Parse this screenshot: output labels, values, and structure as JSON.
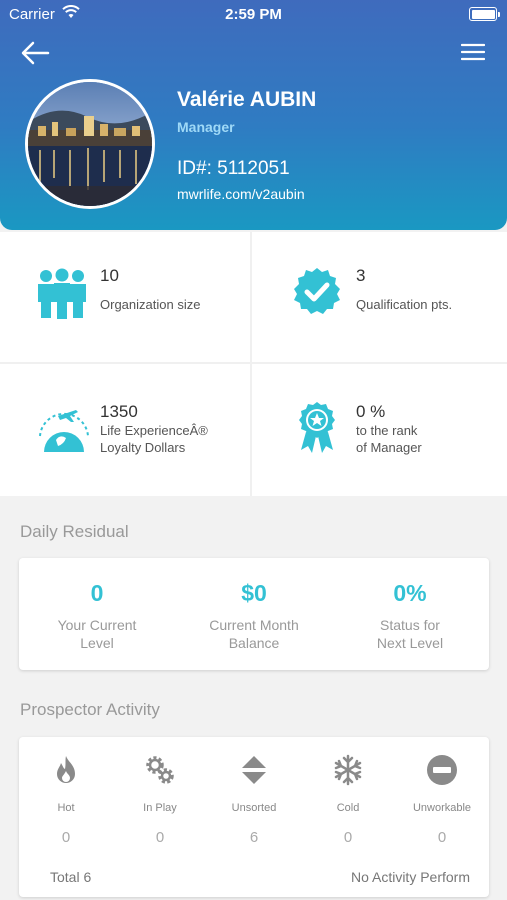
{
  "statusbar": {
    "carrier": "Carrier",
    "time": "2:59 PM"
  },
  "profile": {
    "name": "Valérie AUBIN",
    "role": "Manager",
    "id": "ID#: 5112051",
    "url": "mwrlife.com/v2aubin"
  },
  "stats": [
    {
      "value": "10",
      "label_line1": "Organization size",
      "label_line2": "",
      "icon": "team-icon"
    },
    {
      "value": "3",
      "label_line1": "Qualification pts.",
      "label_line2": "",
      "icon": "check-badge-icon"
    },
    {
      "value": "1350",
      "label_line1": "Life ExperienceÂ®",
      "label_line2": "Loyalty Dollars",
      "icon": "airplane-globe-icon"
    },
    {
      "value": "0 %",
      "label_line1": "to the rank",
      "label_line2": "of Manager",
      "icon": "award-ribbon-icon"
    }
  ],
  "daily_residual": {
    "title": "Daily Residual",
    "items": [
      {
        "value": "0",
        "label_line1": "Your Current",
        "label_line2": "Level"
      },
      {
        "value": "$0",
        "label_line1": "Current Month",
        "label_line2": "Balance"
      },
      {
        "value": "0%",
        "label_line1": "Status for",
        "label_line2": "Next Level"
      }
    ]
  },
  "prospector": {
    "title": "Prospector Activity",
    "items": [
      {
        "label": "Hot",
        "count": "0",
        "icon": "flame-icon"
      },
      {
        "label": "In Play",
        "count": "0",
        "icon": "gears-icon"
      },
      {
        "label": "Unsorted",
        "count": "6",
        "icon": "up-down-arrows-icon"
      },
      {
        "label": "Cold",
        "count": "0",
        "icon": "snowflake-icon"
      },
      {
        "label": "Unworkable",
        "count": "0",
        "icon": "minus-circle-icon"
      }
    ],
    "total": "Total 6",
    "status": "No Activity Perform"
  },
  "colors": {
    "accent": "#33c1d4",
    "header_top": "#3f6bbd",
    "header_bottom": "#1a98c2"
  }
}
